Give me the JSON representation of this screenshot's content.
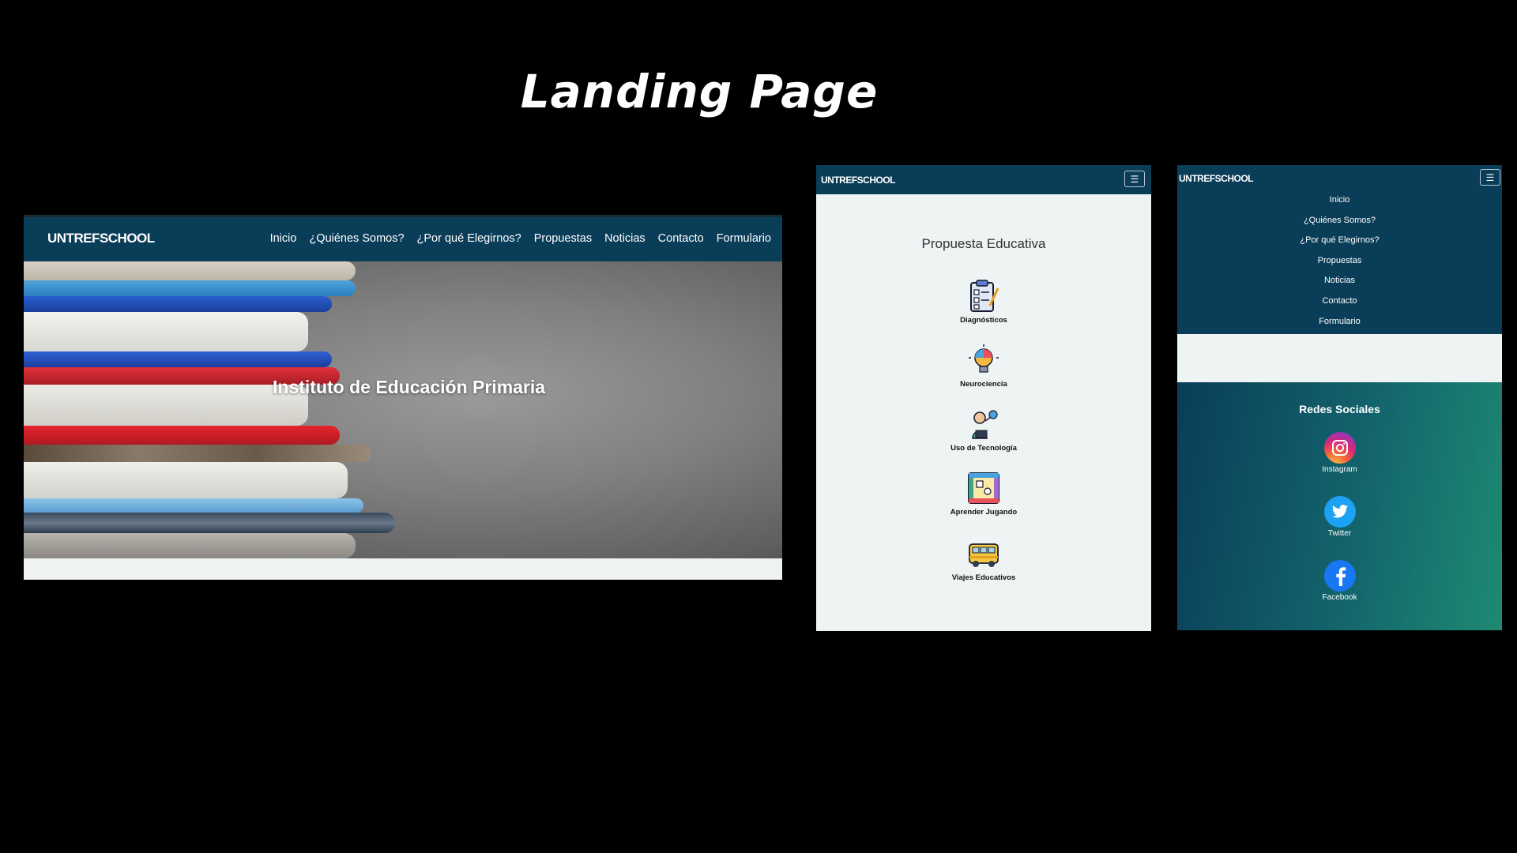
{
  "slide": {
    "title": "Landing Page"
  },
  "brand": "UNTREFSCHOOL",
  "nav": [
    "Inicio",
    "¿Quiénes Somos?",
    "¿Por qué Elegirnos?",
    "Propuestas",
    "Noticias",
    "Contacto",
    "Formulario"
  ],
  "hero": {
    "title": "Instituto de Educación Primaria"
  },
  "propuesta": {
    "title": "Propuesta Educativa",
    "items": [
      "Diagnósticos",
      "Neurociencia",
      "Uso de Tecnología",
      "Aprender Jugando",
      "Viajes Educativos"
    ]
  },
  "social": {
    "title": "Redes Sociales",
    "items": [
      "Instagram",
      "Twitter",
      "Facebook"
    ]
  },
  "icons": {
    "menu": "hamburger-icon"
  },
  "colors": {
    "navbar": "#0a3d58",
    "social_gradient_end": "#1e8a72",
    "background": "#000000"
  }
}
